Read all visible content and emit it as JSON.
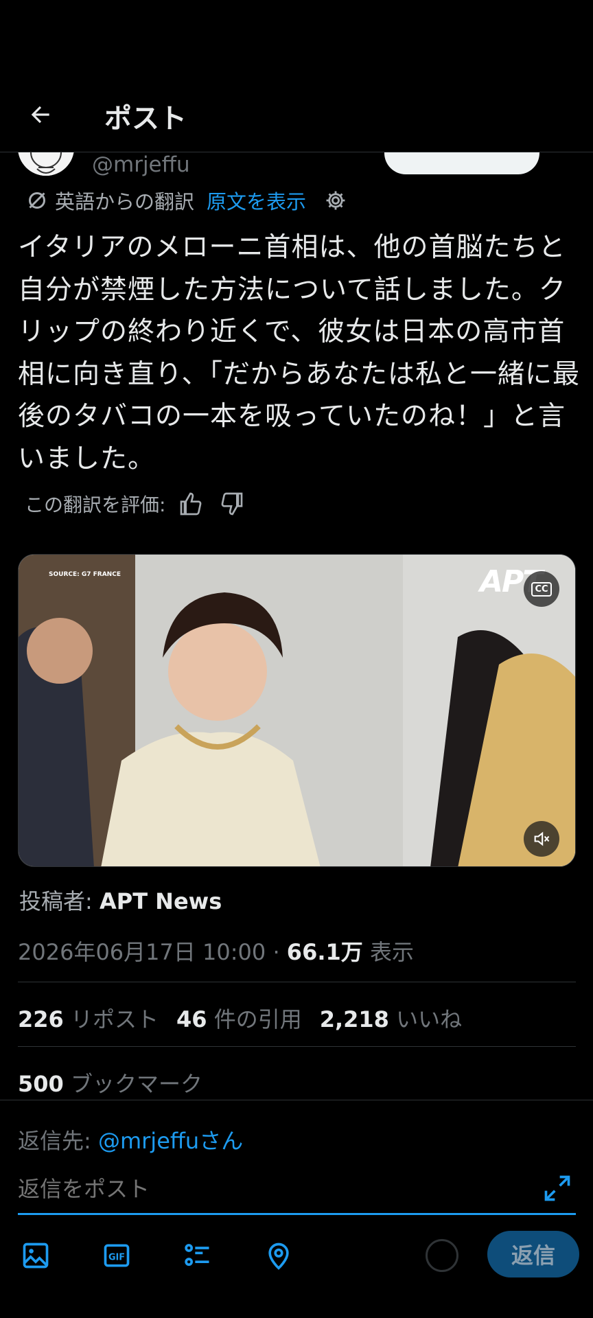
{
  "header": {
    "title": "ポスト"
  },
  "author": {
    "handle": "@mrjeffu"
  },
  "translation": {
    "label": "英語からの翻訳",
    "show_original": "原文を表示"
  },
  "post": {
    "text": "イタリアのメローニ首相は、他の首脳たちと自分が禁煙した方法について話しました。クリップの終わり近くで、彼女は日本の高市首相に向き直り、「だからあなたは私と一緒に最後のタバコの一本を吸っていたのね！」と言いました。"
  },
  "rate": {
    "label": "この翻訳を評価:"
  },
  "media": {
    "source_tag": "SOURCE: G7 FRANCE",
    "logo": "APT",
    "cc_label": "CC"
  },
  "posted_by": {
    "label": "投稿者:",
    "name": "APT News"
  },
  "meta": {
    "datetime": "2026年06月17日 10:00",
    "separator": " · ",
    "views": "66.1万",
    "views_label": "表示"
  },
  "stats": {
    "reposts": "226",
    "reposts_label": "リポスト",
    "quotes": "46",
    "quotes_label": "件の引用",
    "likes": "2,218",
    "likes_label": "いいね",
    "bookmarks": "500",
    "bookmarks_label": "ブックマーク"
  },
  "reply": {
    "reply_to_label": "返信先:",
    "reply_to_mention": "@mrjeffuさん",
    "placeholder": "返信をポスト",
    "button_label": "返信"
  },
  "colors": {
    "accent": "#1d9bf0",
    "background": "#000000",
    "reply_button": "#0e4d7a"
  }
}
